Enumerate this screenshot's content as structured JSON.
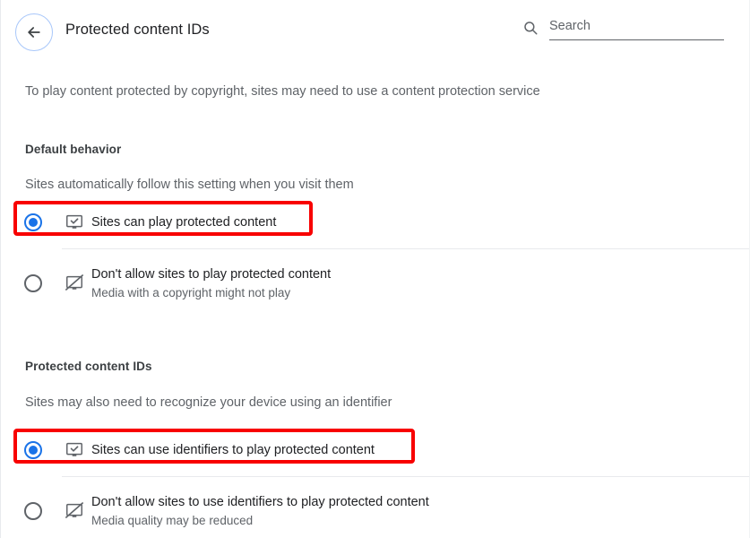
{
  "header": {
    "back_label": "Back",
    "back_icon": "arrow-left-icon",
    "title": "Protected content IDs"
  },
  "search": {
    "icon": "search-icon",
    "placeholder": "Search",
    "value": ""
  },
  "intro": "To play content protected by copyright, sites may need to use a content protection service",
  "sections": [
    {
      "title": "Default behavior",
      "subtitle": "Sites automatically follow this setting when you visit them",
      "options": [
        {
          "label": "Sites can play protected content",
          "description": "",
          "icon": "monitor-check-icon",
          "selected": true,
          "highlighted": true
        },
        {
          "label": "Don't allow sites to play protected content",
          "description": "Media with a copyright might not play",
          "icon": "monitor-off-icon",
          "selected": false,
          "highlighted": false
        }
      ]
    },
    {
      "title": "Protected content IDs",
      "subtitle": "Sites may also need to recognize your device using an identifier",
      "options": [
        {
          "label": "Sites can use identifiers to play protected content",
          "description": "",
          "icon": "monitor-check-icon",
          "selected": true,
          "highlighted": true
        },
        {
          "label": "Don't allow sites to use identifiers to play protected content",
          "description": "Media quality may be reduced",
          "icon": "monitor-off-icon",
          "selected": false,
          "highlighted": false
        }
      ]
    }
  ],
  "colors": {
    "accent": "#1a73e8",
    "annotation": "#f80000",
    "text_primary": "#202124",
    "text_secondary": "#5f6368",
    "divider": "#e8eaed",
    "focus_ring": "#a8c7fa"
  }
}
